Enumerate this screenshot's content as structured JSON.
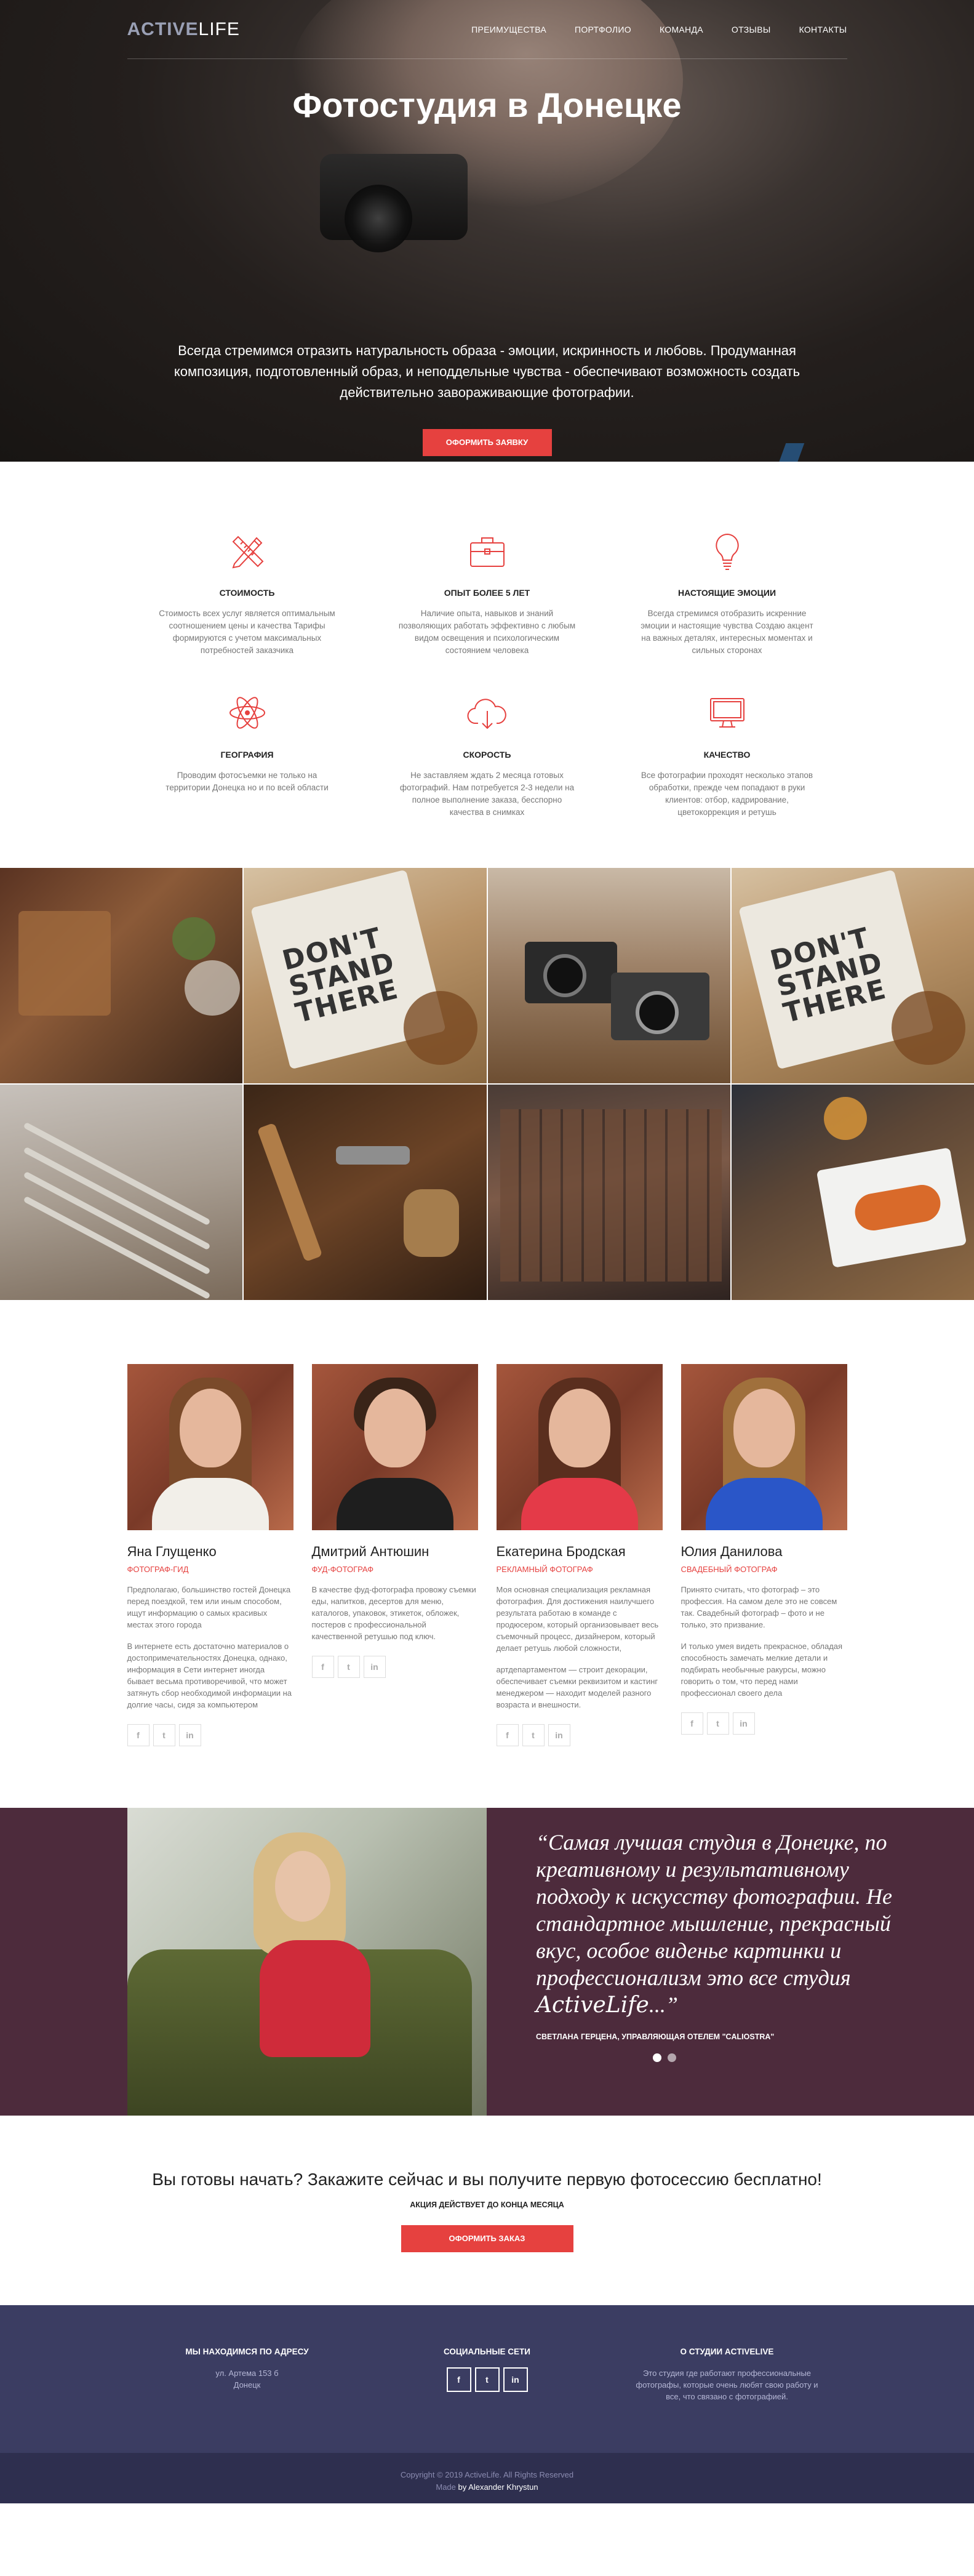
{
  "brand": {
    "logo_part1": "ACTIVE",
    "logo_part2": "LIFE"
  },
  "nav": [
    "ПРЕИМУЩЕСТВА",
    "ПОРТФОЛИО",
    "КОМАНДА",
    "ОТЗЫВЫ",
    "КОНТАКТЫ"
  ],
  "hero": {
    "title": "Фотостудия в Донецке",
    "lead": "Всегда стремимся отразить натуральность образа - эмоции, искринность и любовь. Продуманная композиция, подготовленный образ, и неподдельные чувства - обеспечивают возможность создать действительно завораживающие фотографии.",
    "button": "ОФОРМИТЬ ЗАЯВКУ"
  },
  "features": [
    {
      "icon": "pencil-ruler-icon",
      "title": "СТОИМОСТЬ",
      "text": "Стоимость всех услуг является оптимальным соотношением цены и качества Тарифы формируются с учетом максимальных потребностей заказчика"
    },
    {
      "icon": "briefcase-icon",
      "title": "ОПЫТ БОЛЕЕ 5 ЛЕТ",
      "text": "Наличие опыта, навыков и знаний позволяющих работать эффективно с любым видом освещения и психологическим состоянием человека"
    },
    {
      "icon": "lightbulb-icon",
      "title": "НАСТОЯЩИЕ ЭМОЦИИ",
      "text": "Всегда стремимся отобразить искренние эмоции и настоящие чувства Создаю акцент на важных деталях, интересных моментах и сильных сторонах"
    },
    {
      "icon": "atom-icon",
      "title": "ГЕОГРАФИЯ",
      "text": "Проводим фотосъемки не только на территории Донецка но и по всей области"
    },
    {
      "icon": "cloud-download-icon",
      "title": "СКОРОСТЬ",
      "text": "Не заставляем ждать 2 месяца готовых фотографий. Нам потребуется 2-3 недели на полное выполнение заказа, бесспорно качества в снимках"
    },
    {
      "icon": "monitor-icon",
      "title": "КАЧЕСТВО",
      "text": "Все фотографии проходят несколько этапов обработки, прежде чем попадают в руки клиентов: отбор, кадрирование, цветокоррекция и ретушь"
    }
  ],
  "gallery_poster": "DON'T STAND THERE",
  "team": [
    {
      "name": "Яна Глущенко",
      "role": "ФОТОГРАФ-ГИД",
      "p1": "Предполагаю, большинство гостей Донецка перед поездкой, тем или иным способом, ищут информацию о самых красивых местах этого города",
      "p2": "В интернете есть достаточно материалов о достопримечательностях Донецка, однако, информация в Сети интернет иногда бывает весьма противоречивой, что может затянуть сбор необходимой информации на долгие часы, сидя за компьютером",
      "hair": "#7a4a2a",
      "top": "#f2efe9"
    },
    {
      "name": "Дмитрий Антюшин",
      "role": "ФУД-ФОТОГРАФ",
      "p1": "В качестве фуд-фотографа провожу съемки еды, напитков, десертов для меню, каталогов, упаковок, этикеток, обложек, постеров с профессиональной качественной ретушью под ключ.",
      "p2": "",
      "hair": "#3a2418",
      "top": "#1e1e1e"
    },
    {
      "name": "Екатерина Бродская",
      "role": "РЕКЛАМНЫЙ ФОТОГРАФ",
      "p1": "Моя основная специализация рекламная фотография. Для достижения наилучшего результата работаю в команде с продюсером, который организовывает весь съемочный процесс, дизайнером, который делает ретушь любой сложности,",
      "p2": "артдепартаментом — строит декорации, обеспечивает съемки реквизитом и кастинг менеджером — находит моделей разного возраста и внешности.",
      "hair": "#5a2e1e",
      "top": "#e43a48"
    },
    {
      "name": "Юлия Данилова",
      "role": "СВАДЕБНЫЙ ФОТОГРАФ",
      "p1": "Принято считать, что фотограф – это профессия. На самом деле это не совсем так. Свадебный фотограф – фото и не только, это призвание.",
      "p2": "И только умея видеть прекрасное, обладая способность замечать мелкие детали и подбирать необычные ракурсы, можно говорить о том, что перед нами профессионал своего дела",
      "hair": "#a0703c",
      "top": "#2a56c8"
    }
  ],
  "social_glyphs": {
    "facebook": "f",
    "twitter": "t",
    "linkedin": "in"
  },
  "testimonial": {
    "quote_part1": "“Самая лучшая студия в Донецке, по креативному и результативному подходу к искусству фотографии. Не стандартное мышление, прекрасный вкус, особое виденье картинки и профессионализм это все студия ",
    "quote_brand": "ActiveLife",
    "quote_end": "...”",
    "author": "СВЕТЛАНА ГЕРЦЕНА, УПРАВЛЯЮЩАЯ ОТЕЛЕМ \"CALIOSTRA\""
  },
  "cta": {
    "title": "Вы готовы начать? Закажите сейчас и вы получите первую фотосессию бесплатно!",
    "sub": "АКЦИЯ ДЕЙСТВУЕТ ДО КОНЦА МЕСЯЦА",
    "button": "ОФОРМИТЬ ЗАКАЗ"
  },
  "footer": {
    "address_title": "МЫ НАХОДИМСЯ ПО АДРЕСУ",
    "address_line1": "ул. Артема 153 б",
    "address_line2": "Донецк",
    "social_title": "СОЦИАЛЬНЫЕ СЕТИ",
    "about_title": "О СТУДИИ ACTIVELIVE",
    "about_text": "Это студия где работают профессиональные фотографы, которые очень любят свою работу и все, что связано с фотографией.",
    "copyright": "Copyright © 2019 ActiveLife. All Rights Reserved",
    "made_prefix": "Made",
    "made_by": "by Alexander Khrystun"
  },
  "colors": {
    "accent": "#e6413f",
    "testimonial_bg": "#4d2b3c",
    "footer_bg": "#3b3d62",
    "copyright_bg": "#2e2f4f"
  }
}
